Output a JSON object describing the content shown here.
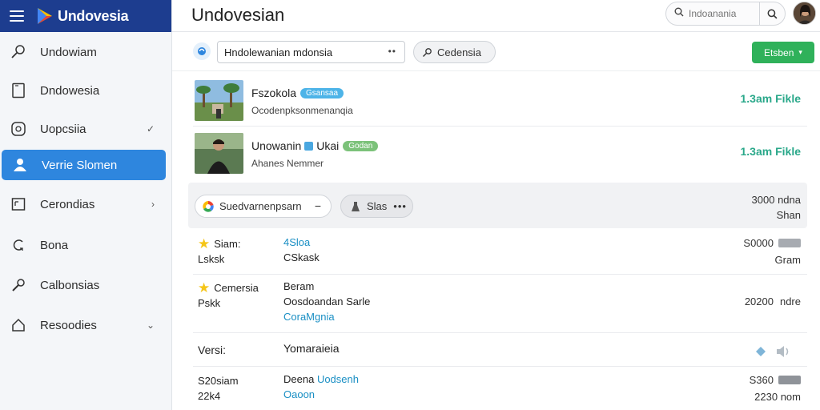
{
  "sidebar": {
    "brand": "Undovesia",
    "items": [
      {
        "label": "Undowiam",
        "icon": "magnifier-icon",
        "chevron": ""
      },
      {
        "label": "Dndowesia",
        "icon": "document-icon",
        "chevron": ""
      },
      {
        "label": "Uopcsiia",
        "icon": "clock-icon",
        "chevron": "✓"
      },
      {
        "label": "Verrie Slomen",
        "icon": "user-icon",
        "chevron": "",
        "active": true
      },
      {
        "label": "Cerondias",
        "icon": "calendar-icon",
        "chevron": "›"
      },
      {
        "label": "Bona",
        "icon": "refresh-icon",
        "chevron": ""
      },
      {
        "label": "Calbonsias",
        "icon": "wrench-icon",
        "chevron": ""
      },
      {
        "label": "Resoodies",
        "icon": "home-icon",
        "chevron": "⌄"
      }
    ]
  },
  "header": {
    "title": "Undovesian",
    "search_placeholder": "Indoanania"
  },
  "toolbar": {
    "select_value": "Hndolewanian mdonsia",
    "pill_label": "Cedensia",
    "primary_label": "Etsben"
  },
  "media_rows": [
    {
      "title": "Fszokola",
      "tag": "Gsansaa",
      "subtitle": "Ocodenpksonmenanqia",
      "right": "1.3am Fikle"
    },
    {
      "title": "Unowanin",
      "title2": "Ukai",
      "tag": "Godan",
      "subtitle": "Ahanes Nemmer",
      "right": "1.3am Fikle"
    }
  ],
  "filter_band": {
    "button1": "Suedvarnenpsarn",
    "button1_action": "−",
    "button2": "Slas",
    "right_line1": "3000 ndna",
    "right_line2": "Shan"
  },
  "data_rows": [
    {
      "col1": [
        "Siam:",
        "Lsksk"
      ],
      "star": true,
      "col2": [
        "4Sloa",
        "CSkask"
      ],
      "col2_link": [
        true,
        false
      ],
      "col3": [
        "S0000",
        "Gram"
      ]
    },
    {
      "col1": [
        "Cemersia",
        "Pskk"
      ],
      "star": true,
      "col2": [
        "Beram",
        "Oosdoandan Sarle",
        "CoraMgnia"
      ],
      "col2_link": [
        false,
        false,
        true
      ],
      "col3": [
        "20200",
        "ndre"
      ]
    },
    {
      "col1": [
        "Versi:"
      ],
      "star": false,
      "col2": [
        "Yomaraieia"
      ],
      "col2_link": [
        false
      ],
      "col3": []
    },
    {
      "col1": [
        "S20siam",
        "22k4"
      ],
      "star": false,
      "col2": [
        "Deena",
        "Oaoon"
      ],
      "col2b": "Uodsenh",
      "col2_link": [
        false,
        true
      ],
      "col3": [
        "S360",
        "2230 nom"
      ]
    }
  ]
}
